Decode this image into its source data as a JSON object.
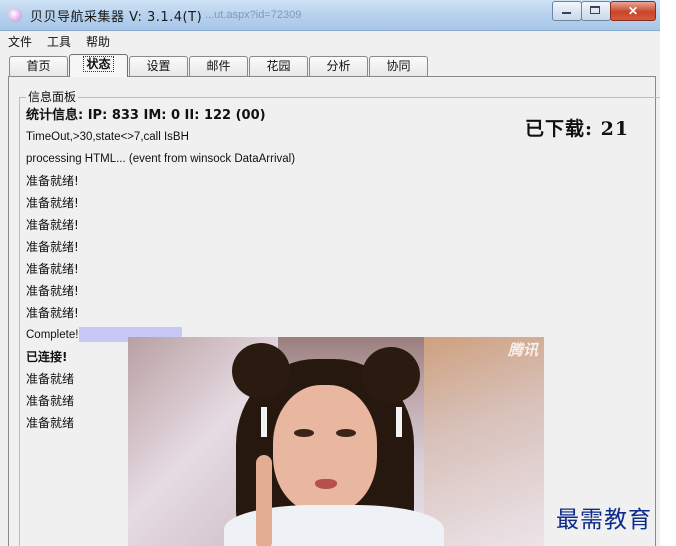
{
  "window": {
    "title": "贝贝导航采集器 V: 3.1.4(T)",
    "title_ghost": "...ut.aspx?id=72309"
  },
  "menu": {
    "items": [
      "文件",
      "工具",
      "帮助"
    ]
  },
  "tabs": [
    {
      "label": "首页",
      "active": false
    },
    {
      "label": "状态",
      "active": true
    },
    {
      "label": "设置",
      "active": false
    },
    {
      "label": "邮件",
      "active": false
    },
    {
      "label": "花园",
      "active": false
    },
    {
      "label": "分析",
      "active": false
    },
    {
      "label": "协同",
      "active": false
    }
  ],
  "info_panel": {
    "legend": "信息面板",
    "stats": "统计信息:  IP: 833 IM: 0 II: 122 (00)",
    "downloaded": "已下载: 21",
    "log": [
      "TimeOut,>30,state<>7,call IsBH",
      "processing HTML... (event from winsock DataArrival)",
      "准备就绪!",
      "准备就绪!",
      "准备就绪!",
      "准备就绪!",
      "准备就绪!",
      "准备就绪!",
      "准备就绪!",
      "Complete!",
      "已连接!",
      "准备就绪",
      "准备就绪",
      "准备就绪"
    ]
  },
  "photo": {
    "logo_text": "腾讯"
  },
  "watermark": "最需教育",
  "colors": {
    "titlebar": "#b9d3ee",
    "window_bg": "#f0f0f0",
    "highlight": "#c8c8f6",
    "close_button": "#c8452b",
    "watermark": "#0d2a8a"
  }
}
